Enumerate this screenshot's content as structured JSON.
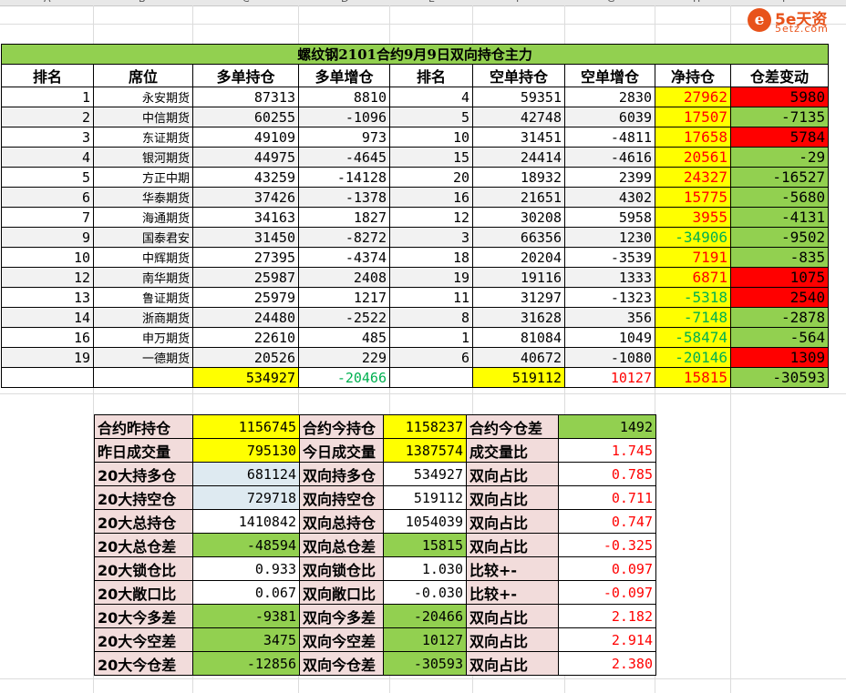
{
  "column_headers": [
    "A",
    "B",
    "C",
    "D",
    "E",
    "F",
    "G",
    "H",
    "I"
  ],
  "logo": {
    "badge": "e",
    "text": "5e天资",
    "sub": "5etz.com"
  },
  "main_table": {
    "title": "螺纹钢2101合约9月9日双向持仓主力",
    "headers": [
      "排名",
      "席位",
      "多单持仓",
      "多单增仓",
      "排名",
      "空单持仓",
      "空单增仓",
      "净持仓",
      "仓差变动"
    ],
    "rows": [
      {
        "rank": "1",
        "seat": "永安期货",
        "long": "87313",
        "long_chg": "8810",
        "rank2": "4",
        "short": "59351",
        "short_chg": "2830",
        "net": "27962",
        "diff": "5980"
      },
      {
        "rank": "2",
        "seat": "中信期货",
        "long": "60255",
        "long_chg": "-1096",
        "rank2": "5",
        "short": "42748",
        "short_chg": "6039",
        "net": "17507",
        "diff": "-7135"
      },
      {
        "rank": "3",
        "seat": "东证期货",
        "long": "49109",
        "long_chg": "973",
        "rank2": "10",
        "short": "31451",
        "short_chg": "-4811",
        "net": "17658",
        "diff": "5784"
      },
      {
        "rank": "4",
        "seat": "银河期货",
        "long": "44975",
        "long_chg": "-4645",
        "rank2": "15",
        "short": "24414",
        "short_chg": "-4616",
        "net": "20561",
        "diff": "-29"
      },
      {
        "rank": "5",
        "seat": "方正中期",
        "long": "43259",
        "long_chg": "-14128",
        "rank2": "20",
        "short": "18932",
        "short_chg": "2399",
        "net": "24327",
        "diff": "-16527"
      },
      {
        "rank": "6",
        "seat": "华泰期货",
        "long": "37426",
        "long_chg": "-1378",
        "rank2": "16",
        "short": "21651",
        "short_chg": "4302",
        "net": "15775",
        "diff": "-5680"
      },
      {
        "rank": "7",
        "seat": "海通期货",
        "long": "34163",
        "long_chg": "1827",
        "rank2": "12",
        "short": "30208",
        "short_chg": "5958",
        "net": "3955",
        "diff": "-4131"
      },
      {
        "rank": "9",
        "seat": "国泰君安",
        "long": "31450",
        "long_chg": "-8272",
        "rank2": "3",
        "short": "66356",
        "short_chg": "1230",
        "net": "-34906",
        "diff": "-9502"
      },
      {
        "rank": "10",
        "seat": "中辉期货",
        "long": "27395",
        "long_chg": "-4374",
        "rank2": "18",
        "short": "20204",
        "short_chg": "-3539",
        "net": "7191",
        "diff": "-835"
      },
      {
        "rank": "12",
        "seat": "南华期货",
        "long": "25987",
        "long_chg": "2408",
        "rank2": "19",
        "short": "19116",
        "short_chg": "1333",
        "net": "6871",
        "diff": "1075"
      },
      {
        "rank": "13",
        "seat": "鲁证期货",
        "long": "25979",
        "long_chg": "1217",
        "rank2": "11",
        "short": "31297",
        "short_chg": "-1323",
        "net": "-5318",
        "diff": "2540"
      },
      {
        "rank": "14",
        "seat": "浙商期货",
        "long": "24480",
        "long_chg": "-2522",
        "rank2": "8",
        "short": "31628",
        "short_chg": "356",
        "net": "-7148",
        "diff": "-2878"
      },
      {
        "rank": "16",
        "seat": "申万期货",
        "long": "22610",
        "long_chg": "485",
        "rank2": "1",
        "short": "81084",
        "short_chg": "1049",
        "net": "-58474",
        "diff": "-564"
      },
      {
        "rank": "19",
        "seat": "一德期货",
        "long": "20526",
        "long_chg": "229",
        "rank2": "6",
        "short": "40672",
        "short_chg": "-1080",
        "net": "-20146",
        "diff": "1309"
      }
    ],
    "totals": {
      "long": "534927",
      "long_chg": "-20466",
      "short": "519112",
      "short_chg": "10127",
      "net": "15815",
      "diff": "-30593"
    }
  },
  "summary_table": {
    "rows": [
      [
        "合约昨持仓",
        "1156745",
        "合约今持仓",
        "1158237",
        "合约今仓差",
        "1492"
      ],
      [
        "昨日成交量",
        "795130",
        "今日成交量",
        "1387574",
        "成交量比",
        "1.745"
      ],
      [
        "20大持多仓",
        "681124",
        "双向持多仓",
        "534927",
        "双向占比",
        "0.785"
      ],
      [
        "20大持空仓",
        "729718",
        "双向持空仓",
        "519112",
        "双向占比",
        "0.711"
      ],
      [
        "20大总持仓",
        "1410842",
        "双向总持仓",
        "1054039",
        "双向占比",
        "0.747"
      ],
      [
        "20大总仓差",
        "-48594",
        "双向总仓差",
        "15815",
        "双向占比",
        "-0.325"
      ],
      [
        "20大锁仓比",
        "0.933",
        "双向锁仓比",
        "1.030",
        "比较+-",
        "0.097"
      ],
      [
        "20大敞口比",
        "0.067",
        "双向敞口比",
        "-0.030",
        "比较+-",
        "-0.097"
      ],
      [
        "20大今多差",
        "-9381",
        "双向今多差",
        "-20466",
        "双向占比",
        "2.182"
      ],
      [
        "20大今空差",
        "3475",
        "双向今空差",
        "10127",
        "双向占比",
        "2.914"
      ],
      [
        "20大今仓差",
        "-12856",
        "双向今仓差",
        "-30593",
        "双向占比",
        "2.380"
      ]
    ]
  },
  "colors": {
    "title_green": "#92d050",
    "yellow": "#ffff00",
    "red": "#ff0000",
    "pink": "#f2dcdb",
    "light_blue": "#deeaf1",
    "text_green": "#00b050"
  }
}
